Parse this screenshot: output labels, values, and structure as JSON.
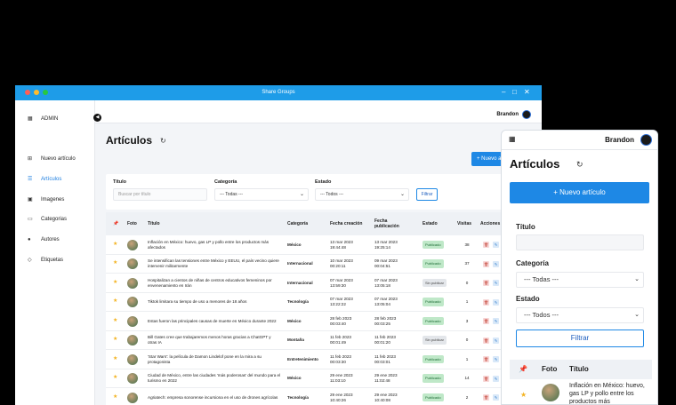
{
  "window": {
    "title": "Share Groups"
  },
  "topbar": {
    "user": "Brandon"
  },
  "sidebar": {
    "items": [
      {
        "label": "ADMIN",
        "icon": "grid-icon"
      },
      {
        "label": "Nuevo artículo",
        "icon": "plus-square-icon"
      },
      {
        "label": "Artículos",
        "icon": "list-icon"
      },
      {
        "label": "Imagenes",
        "icon": "image-icon"
      },
      {
        "label": "Categorias",
        "icon": "folder-icon"
      },
      {
        "label": "Autores",
        "icon": "user-icon"
      },
      {
        "label": "Etiquetas",
        "icon": "tag-icon"
      }
    ]
  },
  "page": {
    "title": "Artículos",
    "new_button": "+ Nuevo artículo"
  },
  "filters": {
    "titulo_label": "Título",
    "titulo_placeholder": "Buscar por título",
    "categoria_label": "Categoría",
    "categoria_value": "--- Todas ---",
    "estado_label": "Estado",
    "estado_value": "--- Todos ---",
    "filtrar_button": "Filtrar"
  },
  "table": {
    "headers": [
      "Foto",
      "Título",
      "Categoría",
      "Fecha creación",
      "Fecha publicación",
      "Estado",
      "Visitas",
      "Acciones"
    ],
    "rows": [
      {
        "title": "Inflación en México: huevo, gas LP y pollo entre los productos más afectados",
        "category": "México",
        "created": "13 mar 2023 19:44:48",
        "published": "13 mar 2023 19:25:14",
        "status": "Publicado",
        "visits": "38"
      },
      {
        "title": "Se intensifican las tensiones entre México y EEUU, el país vecino quiere intervenir militarmente",
        "category": "Internacional",
        "created": "10 mar 2023 00:20:11",
        "published": "09 mar 2023 00:04:51",
        "status": "Publicado",
        "visits": "37"
      },
      {
        "title": "Hospitalizan a cientos de niñas de centros educativos femeninos por envenenamiento en Irán",
        "category": "Internacional",
        "created": "07 mar 2023 13:59:30",
        "published": "07 mar 2023 13:05:18",
        "status": "Sin publicar",
        "visits": "0"
      },
      {
        "title": "Tiktok limitara su tiempo de uso a menores de 18 años",
        "category": "Tecnología",
        "created": "07 mar 2023 13:22:22",
        "published": "07 mar 2023 13:05:04",
        "status": "Publicado",
        "visits": "1"
      },
      {
        "title": "Estas fueron las principales causas de muerte en México durante 2022",
        "category": "México",
        "created": "28 feb 2023 00:03:40",
        "published": "28 feb 2023 00:03:25",
        "status": "Publicado",
        "visits": "3"
      },
      {
        "title": "Bill Gates cree que trabajaremos menos horas gracias a ChatGPT y otras IA",
        "category": "Montaña",
        "created": "11 feb 2023 00:01:49",
        "published": "11 feb 2023 00:01:20",
        "status": "Sin publicar",
        "visits": "0"
      },
      {
        "title": "'Star Wars': la película de Damon Lindelof pone en la mira a su protagonista",
        "category": "Entretenimiento",
        "created": "11 feb 2023 00:03:30",
        "published": "11 feb 2023 00:03:01",
        "status": "Publicado",
        "visits": "1"
      },
      {
        "title": "Ciudad de México, entre las ciudades 'más poderosas' del mundo para el turismo en 2022",
        "category": "México",
        "created": "29 ene 2023 11:03:10",
        "published": "29 ene 2023 11:02:48",
        "status": "Publicado",
        "visits": "14"
      },
      {
        "title": "Agriatech: empresa sonorense incursiona en el uso de drones agrícolas",
        "category": "Tecnología",
        "created": "29 ene 2023 10:40:26",
        "published": "29 ene 2023 10:40:08",
        "status": "Publicado",
        "visits": "2"
      }
    ]
  },
  "mobile": {
    "user": "Brandon",
    "title": "Artículos",
    "new_button": "+ Nuevo artículo",
    "titulo_label": "Título",
    "categoria_label": "Categoría",
    "categoria_value": "--- Todas ---",
    "estado_label": "Estado",
    "estado_value": "--- Todos ---",
    "filtrar_button": "Filtrar",
    "col_foto": "Foto",
    "col_titulo": "Título",
    "first_row_title": "Inflación en México: huevo, gas LP y pollo entre los productos más"
  },
  "colors": {
    "accent": "#1e88e5",
    "titlebar": "#1e9ce8",
    "published": "#bfe8c8",
    "star": "#f3b321"
  }
}
